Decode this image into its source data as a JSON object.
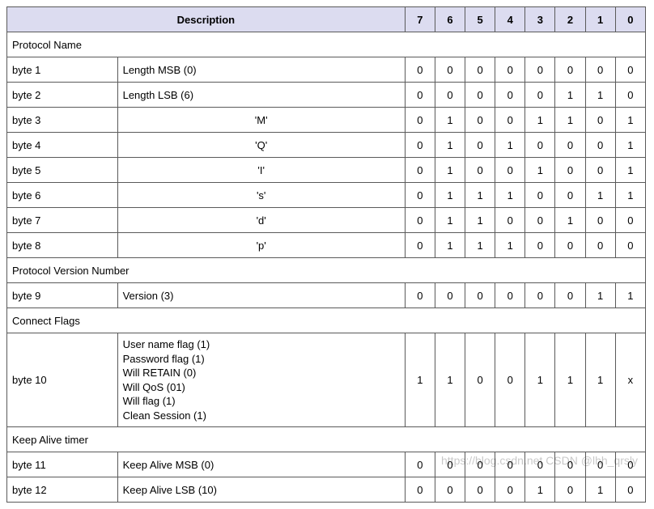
{
  "header": {
    "desc": "Description",
    "bits": [
      "7",
      "6",
      "5",
      "4",
      "3",
      "2",
      "1",
      "0"
    ]
  },
  "sections": {
    "protocol_name": "Protocol Name",
    "protocol_version": "Protocol Version Number",
    "connect_flags": "Connect Flags",
    "keep_alive": "Keep Alive timer"
  },
  "rows": {
    "b1": {
      "label": "byte 1",
      "desc": "Length MSB (0)",
      "bits": [
        "0",
        "0",
        "0",
        "0",
        "0",
        "0",
        "0",
        "0"
      ]
    },
    "b2": {
      "label": "byte 2",
      "desc": "Length LSB (6)",
      "bits": [
        "0",
        "0",
        "0",
        "0",
        "0",
        "1",
        "1",
        "0"
      ]
    },
    "b3": {
      "label": "byte 3",
      "desc": "'M'",
      "bits": [
        "0",
        "1",
        "0",
        "0",
        "1",
        "1",
        "0",
        "1"
      ]
    },
    "b4": {
      "label": "byte 4",
      "desc": "'Q'",
      "bits": [
        "0",
        "1",
        "0",
        "1",
        "0",
        "0",
        "0",
        "1"
      ]
    },
    "b5": {
      "label": "byte 5",
      "desc": "'I'",
      "bits": [
        "0",
        "1",
        "0",
        "0",
        "1",
        "0",
        "0",
        "1"
      ]
    },
    "b6": {
      "label": "byte 6",
      "desc": "'s'",
      "bits": [
        "0",
        "1",
        "1",
        "1",
        "0",
        "0",
        "1",
        "1"
      ]
    },
    "b7": {
      "label": "byte 7",
      "desc": "'d'",
      "bits": [
        "0",
        "1",
        "1",
        "0",
        "0",
        "1",
        "0",
        "0"
      ]
    },
    "b8": {
      "label": "byte 8",
      "desc": "'p'",
      "bits": [
        "0",
        "1",
        "1",
        "1",
        "0",
        "0",
        "0",
        "0"
      ]
    },
    "b9": {
      "label": "byte 9",
      "desc": "Version (3)",
      "bits": [
        "0",
        "0",
        "0",
        "0",
        "0",
        "0",
        "1",
        "1"
      ]
    },
    "b10": {
      "label": "byte 10",
      "flags": [
        "User name flag (1)",
        "Password flag (1)",
        "Will RETAIN (0)",
        "Will QoS (01)",
        "Will flag (1)",
        "Clean Session (1)"
      ],
      "bits": [
        "1",
        "1",
        "0",
        "0",
        "1",
        "1",
        "1",
        "x"
      ]
    },
    "b11": {
      "label": "byte 11",
      "desc": "Keep Alive MSB (0)",
      "bits": [
        "0",
        "0",
        "0",
        "0",
        "0",
        "0",
        "0",
        "0"
      ]
    },
    "b12": {
      "label": "byte 12",
      "desc": "Keep Alive LSB (10)",
      "bits": [
        "0",
        "0",
        "0",
        "0",
        "1",
        "0",
        "1",
        "0"
      ]
    }
  },
  "watermark": "https://blog.csdn.net CSDN @lhh_qrsly"
}
